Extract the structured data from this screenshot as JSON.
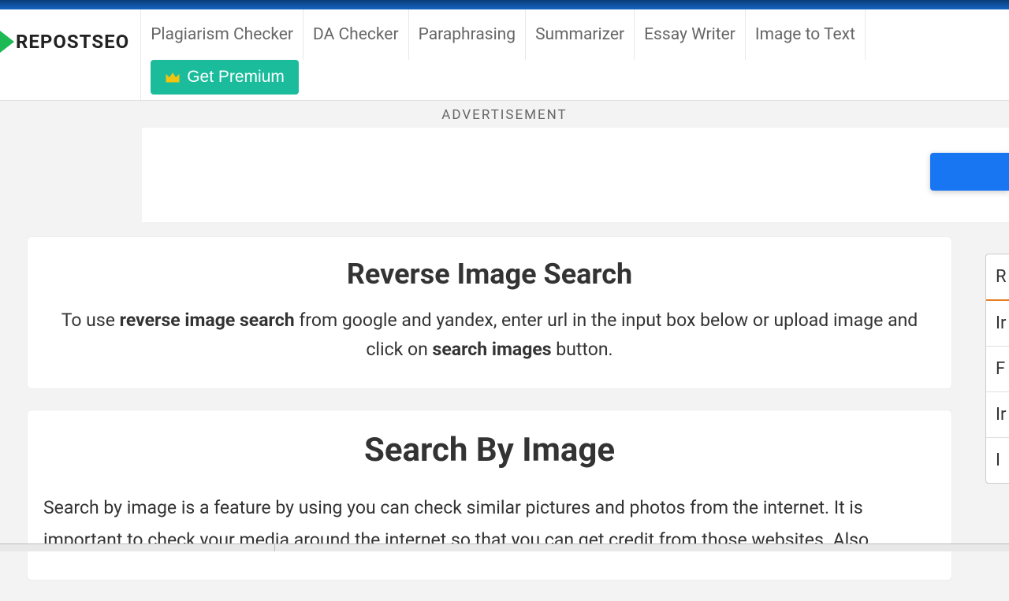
{
  "logo": {
    "text": "REPOSTSEO"
  },
  "nav": {
    "items": [
      "Plagiarism Checker",
      "DA Checker",
      "Paraphrasing",
      "Summarizer",
      "Essay Writer",
      "Image to Text"
    ],
    "premium_label": "Get Premium"
  },
  "ad_label": "ADVERTISEMENT",
  "section1": {
    "title": "Reverse Image Search",
    "desc_pre": "To use ",
    "desc_bold1": "reverse image search",
    "desc_mid": " from google and yandex, enter url in the input box below or upload image and click on ",
    "desc_bold2": "search images",
    "desc_post": " button."
  },
  "section2": {
    "title": "Search By Image",
    "body": "Search by image is a feature by using you can check similar pictures and photos from the internet. It is important to check your media around the internet so that you can get credit from those websites. Also"
  },
  "sidebar": {
    "items": [
      "R",
      "Ir",
      "F",
      "Ir",
      "I"
    ]
  }
}
